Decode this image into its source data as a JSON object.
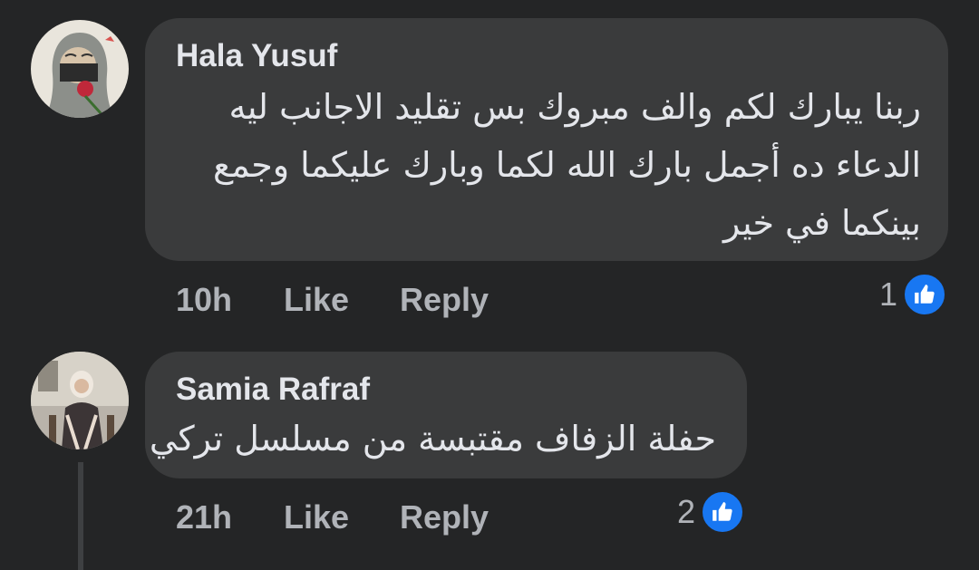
{
  "comments": [
    {
      "author": "Hala Yusuf",
      "lines": [
        "ربنا يبارك لكم والف مبروك بس تقليد الاجانب ليه",
        "الدعاء ده أجمل بارك الله لكما وبارك عليكما وجمع",
        "بينكما في خير"
      ],
      "time": "10h",
      "like_label": "Like",
      "reply_label": "Reply",
      "reaction_count": "1",
      "reaction_icon": "thumbs-up-icon"
    },
    {
      "author": "Samia Rafraf",
      "lines": [
        "حفلة الزفاف مقتبسة من مسلسل تركي"
      ],
      "time": "21h",
      "like_label": "Like",
      "reply_label": "Reply",
      "reaction_count": "2",
      "reaction_icon": "thumbs-up-icon"
    }
  ],
  "colors": {
    "background": "#242526",
    "bubble": "#3a3b3c",
    "text": "#e4e6eb",
    "meta": "#b0b3b8",
    "like_badge": "#1877f2"
  }
}
